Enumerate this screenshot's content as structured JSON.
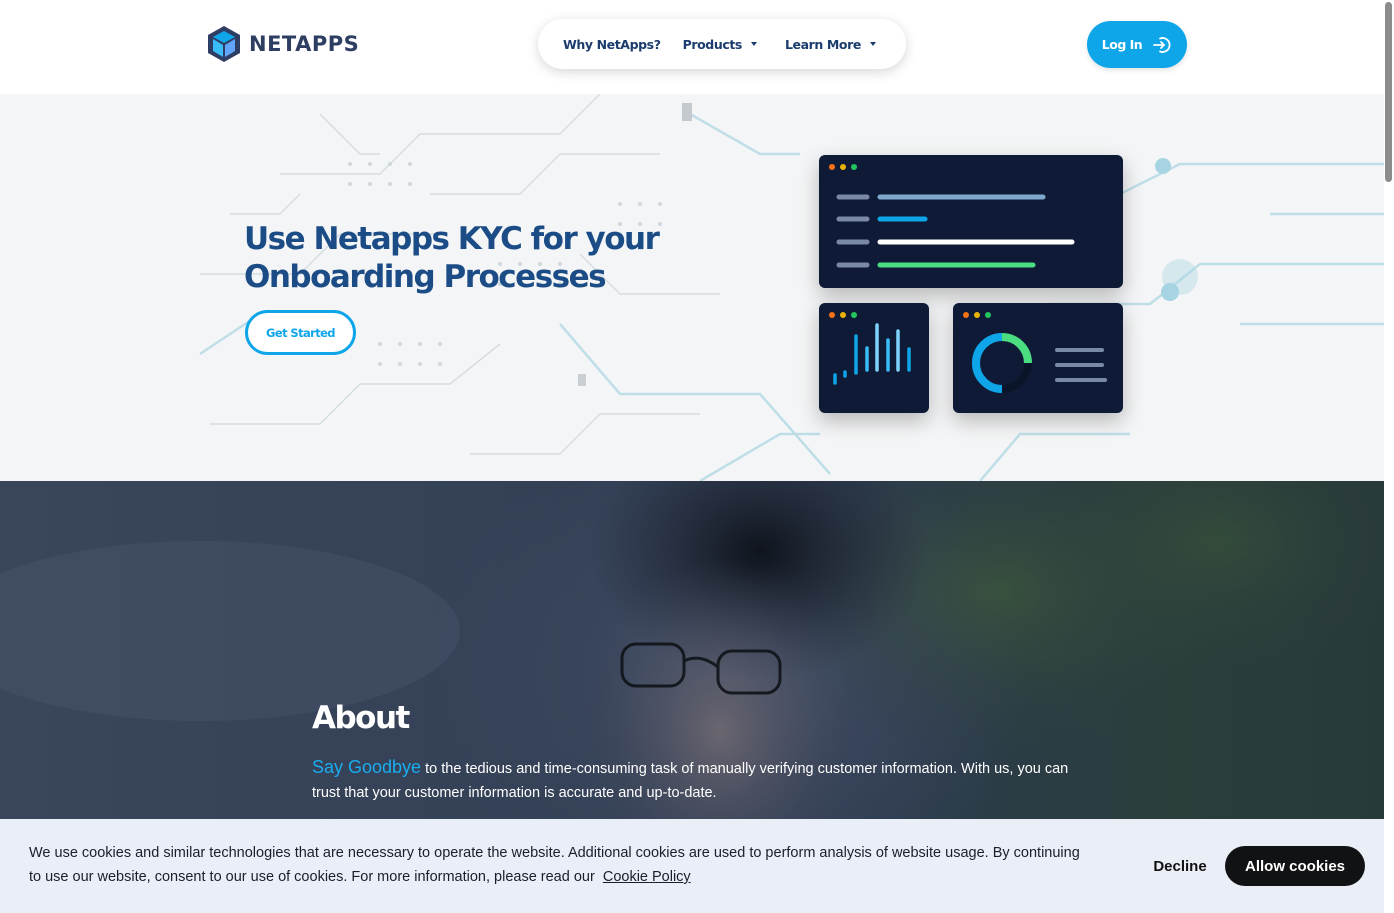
{
  "header": {
    "logo_text": "NETAPPS",
    "nav": [
      {
        "label": "Why NetApps?",
        "has_caret": false
      },
      {
        "label": "Products",
        "has_caret": true
      },
      {
        "label": "Learn More",
        "has_caret": true
      }
    ],
    "login_label": "Log In"
  },
  "hero": {
    "title_line1": "Use Netapps KYC for your",
    "title_line2": "Onboarding Processes",
    "cta_label": "Get Started"
  },
  "about": {
    "title": "About",
    "highlight": "Say Goodbye",
    "text": "to the tedious and time-consuming task of manually verifying customer information. With us, you can trust that your customer information is accurate and up-to-date."
  },
  "cookie": {
    "text": "We use cookies and similar technologies that are necessary to operate the website. Additional cookies are used to perform analysis of website usage. By continuing to use our website, consent to our use of cookies. For more information, please read our",
    "link": "Cookie Policy",
    "decline_label": "Decline",
    "allow_label": "Allow cookies"
  },
  "colors": {
    "accent": "#0ea5e9",
    "navy": "#1b4c86",
    "panel": "#0f1b36",
    "green": "#4ade80"
  }
}
